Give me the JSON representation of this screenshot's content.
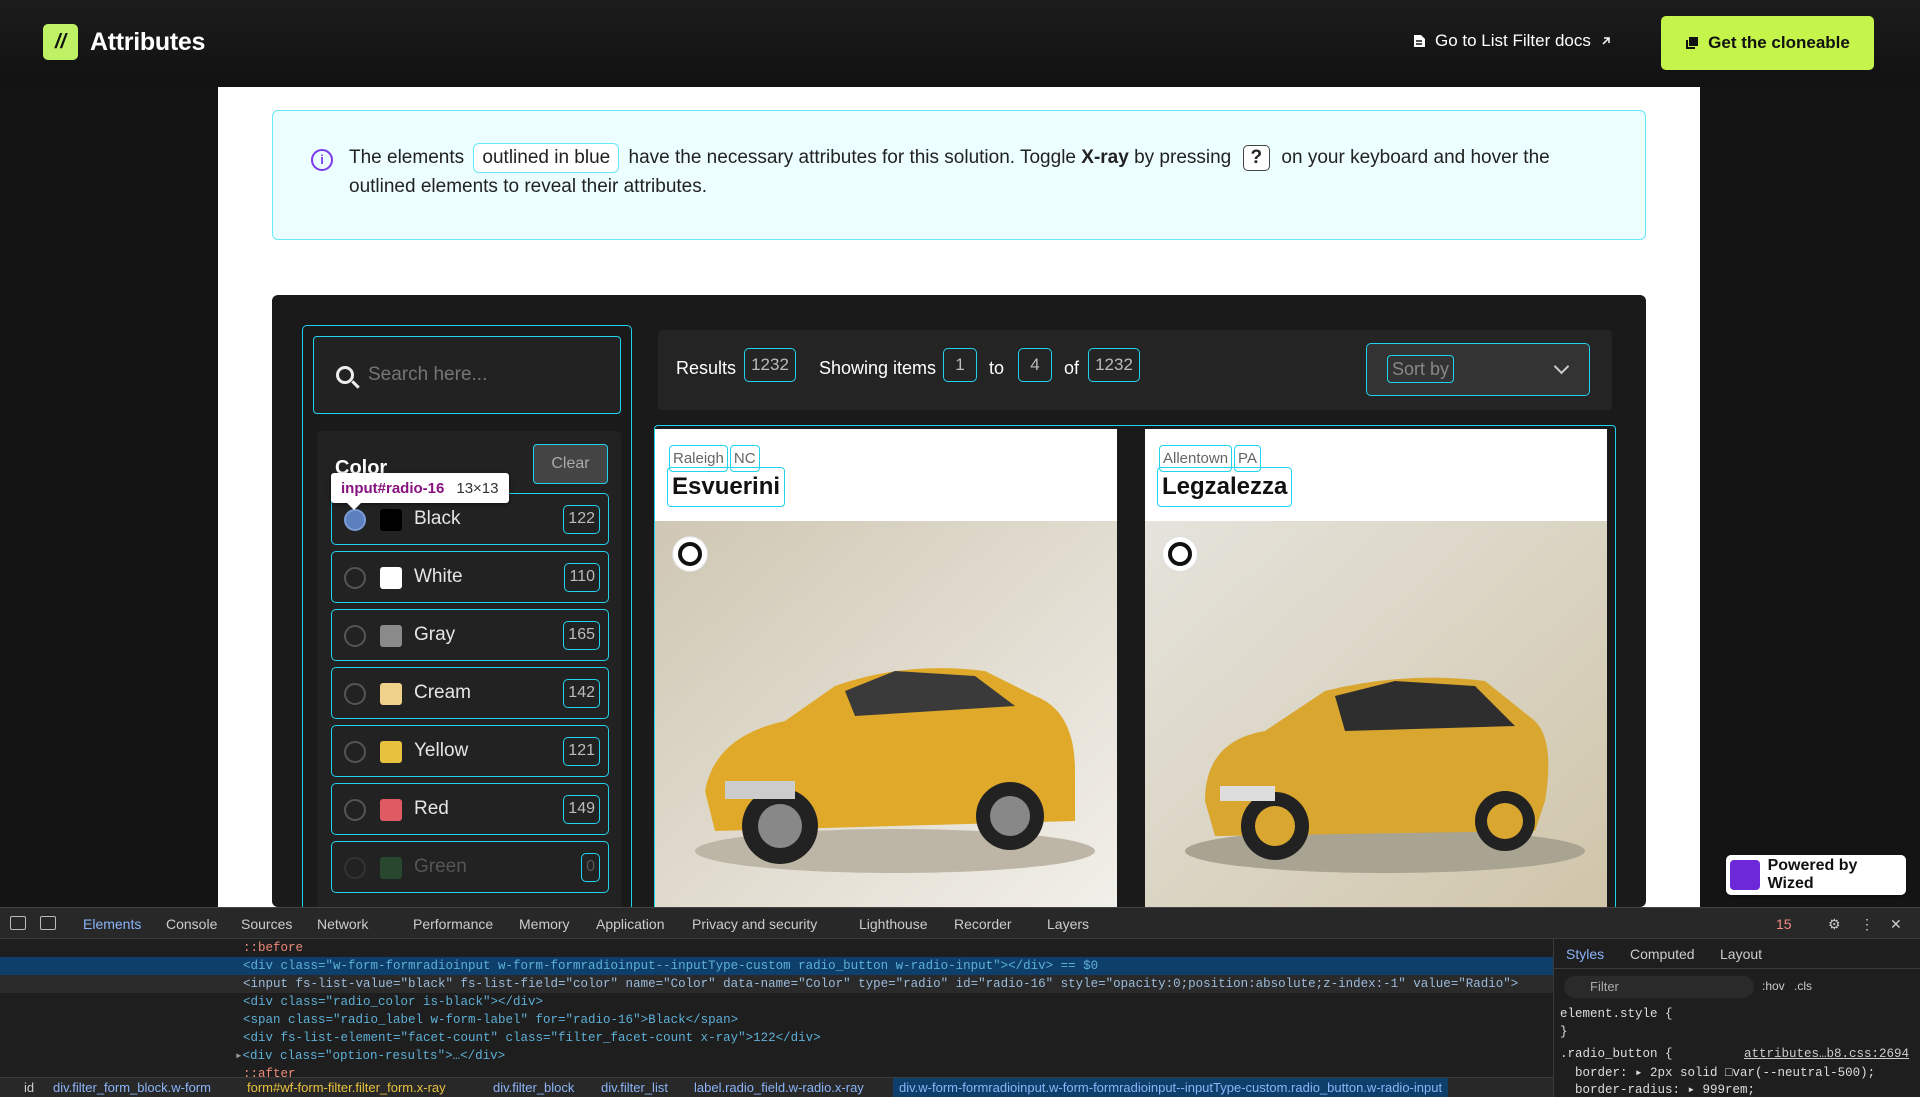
{
  "header": {
    "logo_text": "Attributes",
    "logo_mark": "//",
    "docs_link": "Go to List Filter docs",
    "cta": "Get the cloneable"
  },
  "info": {
    "text_1": "The elements",
    "pill": "outlined in blue",
    "text_2": "have the necessary attributes for this solution. Toggle",
    "strong": "X-ray",
    "text_3": "by pressing",
    "key": "?",
    "text_4": "on your keyboard and hover the outlined elements to reveal their attributes."
  },
  "search": {
    "placeholder": "Search here..."
  },
  "filter": {
    "title": "Color",
    "clear": "Clear",
    "tooltip_selector": "input#radio-16",
    "tooltip_size": "13×13",
    "options": [
      {
        "label": "Black",
        "count": "122",
        "color": "#000000"
      },
      {
        "label": "White",
        "count": "110",
        "color": "#ffffff"
      },
      {
        "label": "Gray",
        "count": "165",
        "color": "#8a8a8a"
      },
      {
        "label": "Cream",
        "count": "142",
        "color": "#f0d18a"
      },
      {
        "label": "Yellow",
        "count": "121",
        "color": "#e8c13e"
      },
      {
        "label": "Red",
        "count": "149",
        "color": "#e05a64"
      },
      {
        "label": "Green",
        "count": "0",
        "color": "#2f6b3a"
      }
    ]
  },
  "results": {
    "results_label": "Results",
    "results_count": "1232",
    "showing": "Showing items",
    "from": "1",
    "to_label": "to",
    "to": "4",
    "of_label": "of",
    "total": "1232",
    "sort_label": "Sort by"
  },
  "cards": [
    {
      "city": "Raleigh",
      "state": "NC",
      "name": "Esvuerini"
    },
    {
      "city": "Allentown",
      "state": "PA",
      "name": "Legzalezza"
    }
  ],
  "wized": "Powered by Wized",
  "devtools": {
    "tabs": [
      "Elements",
      "Console",
      "Sources",
      "Network",
      "Performance",
      "Memory",
      "Application",
      "Privacy and security",
      "Lighthouse",
      "Recorder",
      "Layers"
    ],
    "issues_count": "15",
    "lines": [
      "::before",
      "<div class=\"w-form-formradioinput w-form-formradioinput--inputType-custom radio_button w-radio-input\"></div> == $0",
      "<input fs-list-value=\"black\" fs-list-field=\"color\" name=\"Color\" data-name=\"Color\" type=\"radio\" id=\"radio-16\" style=\"opacity:0;position:absolute;z-index:-1\" value=\"Radio\">",
      "<div class=\"radio_color is-black\"></div>",
      "<span class=\"radio_label w-form-label\" for=\"radio-16\">Black</span>",
      "<div fs-list-element=\"facet-count\" class=\"filter_facet-count x-ray\">122</div>",
      "<div class=\"option-results\">…</div>",
      "::after"
    ],
    "styles_tabs": [
      "Styles",
      "Computed",
      "Layout"
    ],
    "styles_filter": "Filter",
    "styles_hov": ":hov",
    "styles_cls": ".cls",
    "styles_lines": [
      "element.style {",
      "}",
      ".radio_button {",
      "  border: ▸ 2px solid □var(--neutral-500);",
      "  border-radius: ▸ 999rem;"
    ],
    "styles_source": "attributes…b8.css:2694",
    "breadcrumb": [
      "id",
      "div.filter_form_block.w-form",
      "form#wf-form-filter.filter_form.x-ray",
      "div.filter_block",
      "div.filter_list",
      "label.radio_field.w-radio.x-ray",
      "div.w-form-formradioinput.w-form-formradioinput--inputType-custom.radio_button.w-radio-input"
    ]
  }
}
